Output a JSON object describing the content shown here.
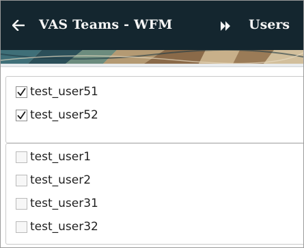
{
  "header": {
    "back_icon": "arrow-left-icon",
    "title": "VAS Teams - WFM",
    "separator_icon": "double-chevron-right-icon",
    "current": "Users",
    "background_color": "#14262f",
    "text_color": "#f5f5f5"
  },
  "selected_users": [
    {
      "label": "test_user51",
      "checked": true
    },
    {
      "label": "test_user52",
      "checked": true
    }
  ],
  "available_users": [
    {
      "label": "test_user1",
      "checked": false
    },
    {
      "label": "test_user2",
      "checked": false
    },
    {
      "label": "test_user31",
      "checked": false
    },
    {
      "label": "test_user32",
      "checked": false
    }
  ]
}
